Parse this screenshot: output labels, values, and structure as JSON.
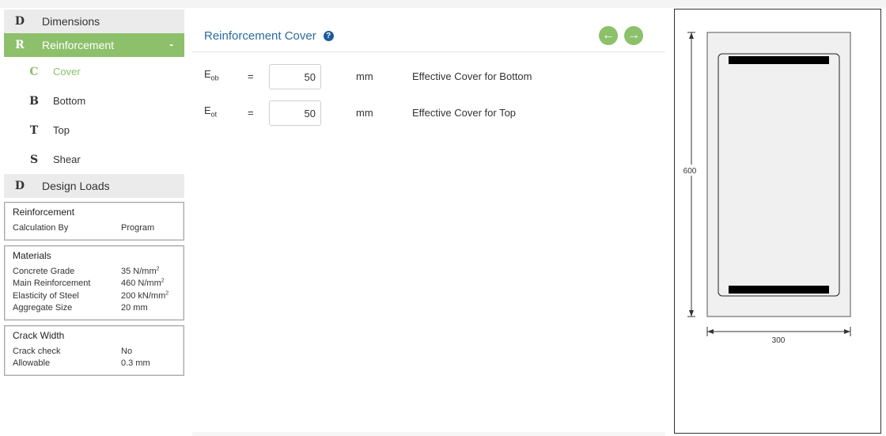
{
  "sidebar": {
    "dimensions": {
      "letter": "D",
      "label": "Dimensions"
    },
    "reinforcement": {
      "letter": "R",
      "label": "Reinforcement",
      "toggle": "-"
    },
    "sub_items": [
      {
        "letter": "C",
        "label": "Cover"
      },
      {
        "letter": "B",
        "label": "Bottom"
      },
      {
        "letter": "T",
        "label": "Top"
      },
      {
        "letter": "S",
        "label": "Shear"
      }
    ],
    "design_loads": {
      "letter": "D",
      "label": "Design Loads"
    }
  },
  "summary": {
    "reinforcement": {
      "title": "Reinforcement",
      "rows": [
        {
          "key": "Calculation By",
          "value": "Program"
        }
      ]
    },
    "materials": {
      "title": "Materials",
      "rows": [
        {
          "key": "Concrete Grade",
          "value": "35 N/mm",
          "sup": "2"
        },
        {
          "key": "Main Reinforcement",
          "value": "460 N/mm",
          "sup": "2"
        },
        {
          "key": "Elasticity of Steel",
          "value": "200 kN/mm",
          "sup": "2"
        },
        {
          "key": "Aggregate Size",
          "value": "20 mm",
          "sup": ""
        }
      ]
    },
    "crack_width": {
      "title": "Crack Width",
      "rows": [
        {
          "key": "Crack check",
          "value": "No"
        },
        {
          "key": "Allowable",
          "value": "0.3 mm"
        }
      ]
    }
  },
  "main": {
    "title": "Reinforcement Cover",
    "help_icon": "question-circle-icon",
    "prev_icon": "arrow-left-circle-icon",
    "next_icon": "arrow-right-circle-icon",
    "fields": [
      {
        "symbol": "E",
        "subscript": "ob",
        "equals": "=",
        "value": "50",
        "unit": "mm",
        "description": "Effective Cover for Bottom"
      },
      {
        "symbol": "E",
        "subscript": "ot",
        "equals": "=",
        "value": "50",
        "unit": "mm",
        "description": "Effective Cover for Top"
      }
    ]
  },
  "diagram": {
    "height_label": "600",
    "width_label": "300",
    "bar_color": "#000000",
    "section_fill": "#f0f0f0"
  },
  "colors": {
    "accent_green": "#8cc06a",
    "title_blue": "#2b6b9e",
    "help_blue": "#1d5a9c"
  }
}
